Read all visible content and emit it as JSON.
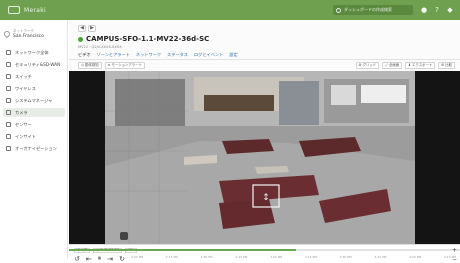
{
  "topbar": {
    "brand": "Meraki",
    "search_placeholder": "ダッシュボードの作成検索",
    "icons": [
      "user-icon",
      "help-icon",
      "bell-icon"
    ]
  },
  "sidebar": {
    "org_label": "ネットワーク",
    "org_value": "San Francisco",
    "items": [
      {
        "label": "ネットワーク全体",
        "icon": "globe-icon",
        "active": false
      },
      {
        "label": "セキュリティ&SD-WAN",
        "icon": "shield-icon",
        "active": false
      },
      {
        "label": "スイッチ",
        "icon": "switch-icon",
        "active": false
      },
      {
        "label": "ワイヤレス",
        "icon": "wifi-icon",
        "active": false
      },
      {
        "label": "システムマネージャ",
        "icon": "device-icon",
        "active": false
      },
      {
        "label": "カメラ",
        "icon": "camera-icon",
        "active": true
      },
      {
        "label": "センサー",
        "icon": "sensor-icon",
        "active": false
      },
      {
        "label": "インサイト",
        "icon": "insight-icon",
        "active": false
      },
      {
        "label": "オーガナイゼーション",
        "icon": "org-icon",
        "active": false
      }
    ]
  },
  "main": {
    "back_label": "◀",
    "forward_label": "▶",
    "title": "CAMPUS-SFO-1.1-MV22-36d-SC",
    "subtitle": "MV22 · Q2JV-XXXX-XXXX",
    "tabs": [
      {
        "label": "ビデオ",
        "active": true
      },
      {
        "label": "ゾーンとアラート",
        "active": false
      },
      {
        "label": "ネットワーク",
        "active": false
      },
      {
        "label": "ステータス",
        "active": false
      },
      {
        "label": "ログとイベント",
        "active": false
      },
      {
        "label": "設定",
        "active": false
      }
    ],
    "toolbar_left": [
      "◎ 動体検知",
      "≡ モーションアラート"
    ],
    "toolbar_right": [
      "⊞ グリッド",
      "⤢ 全画面",
      "⬇ エクスポート",
      "⊞ 比較"
    ]
  },
  "timeline": {
    "live_buttons": [
      "ライブ",
      "◷ 3:42:37 PM",
      "10s"
    ],
    "ticks": [
      "2:00 PM",
      "2:15 PM",
      "2:30 PM",
      "2:45 PM",
      "3:00 PM",
      "3:15 PM",
      "3:30 PM",
      "3:45 PM",
      "4:00 PM",
      "4:15 PM"
    ],
    "progress": 0.58,
    "controls": [
      "↺",
      "⇤",
      "⏸",
      "⇥",
      "↻"
    ],
    "zoom_in": "+",
    "zoom_out": "−"
  },
  "colors": {
    "brand_green": "#6fa04f",
    "accent_link": "#2f6db0",
    "live_dot": "#4aa33a"
  }
}
